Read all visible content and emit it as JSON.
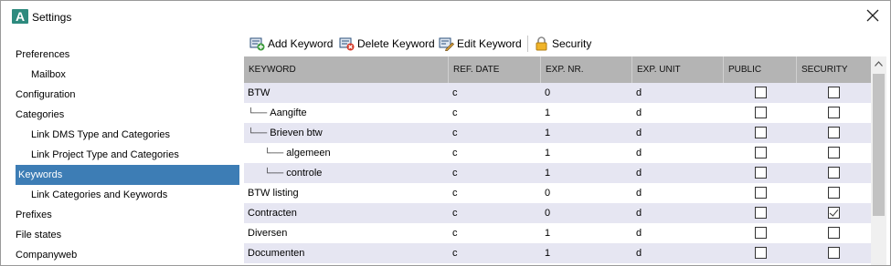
{
  "window": {
    "title": "Settings",
    "logo_letter": "A"
  },
  "sidebar": {
    "items": [
      {
        "label": "Preferences"
      },
      {
        "label": "Mailbox"
      },
      {
        "label": "Configuration"
      },
      {
        "label": "Categories"
      },
      {
        "label": "Link DMS Type and Categories"
      },
      {
        "label": "Link Project Type and Categories"
      },
      {
        "label": "Keywords",
        "selected": true
      },
      {
        "label": "Link Categories and Keywords"
      },
      {
        "label": "Prefixes"
      },
      {
        "label": "File states"
      },
      {
        "label": "Companyweb"
      }
    ]
  },
  "toolbar": {
    "add_label": "Add Keyword",
    "delete_label": "Delete Keyword",
    "edit_label": "Edit Keyword",
    "security_label": "Security"
  },
  "grid": {
    "columns": [
      "KEYWORD",
      "REF. DATE",
      "EXP. NR.",
      "EXP. UNIT",
      "PUBLIC",
      "SECURITY"
    ],
    "rows": [
      {
        "prefix": "",
        "keyword": "BTW",
        "ref_date": "c",
        "exp_nr": "0",
        "exp_unit": "d",
        "public": false,
        "security": false
      },
      {
        "prefix": "└──",
        "keyword": "Aangifte",
        "ref_date": "c",
        "exp_nr": "1",
        "exp_unit": "d",
        "public": false,
        "security": false
      },
      {
        "prefix": "└──",
        "keyword": "Brieven btw",
        "ref_date": "c",
        "exp_nr": "1",
        "exp_unit": "d",
        "public": false,
        "security": false
      },
      {
        "prefix": "└──",
        "keyword": "algemeen",
        "ref_date": "c",
        "exp_nr": "1",
        "exp_unit": "d",
        "public": false,
        "security": false
      },
      {
        "prefix": "└──",
        "keyword": "controle",
        "ref_date": "c",
        "exp_nr": "1",
        "exp_unit": "d",
        "public": false,
        "security": false
      },
      {
        "prefix": "",
        "keyword": "BTW listing",
        "ref_date": "c",
        "exp_nr": "0",
        "exp_unit": "d",
        "public": false,
        "security": false
      },
      {
        "prefix": "",
        "keyword": "Contracten",
        "ref_date": "c",
        "exp_nr": "0",
        "exp_unit": "d",
        "public": false,
        "security": true
      },
      {
        "prefix": "",
        "keyword": "Diversen",
        "ref_date": "c",
        "exp_nr": "1",
        "exp_unit": "d",
        "public": false,
        "security": false
      },
      {
        "prefix": "",
        "keyword": "Documenten",
        "ref_date": "c",
        "exp_nr": "1",
        "exp_unit": "d",
        "public": false,
        "security": false
      }
    ]
  },
  "icons": {
    "add": "add-keyword-icon",
    "delete": "delete-keyword-icon",
    "edit": "edit-keyword-icon",
    "security": "lock-icon"
  },
  "colors": {
    "selection": "#3d7db5",
    "header_bg": "#b4b4b4",
    "alt_row": "#e6e6f2",
    "logo": "#2d8a7e"
  }
}
